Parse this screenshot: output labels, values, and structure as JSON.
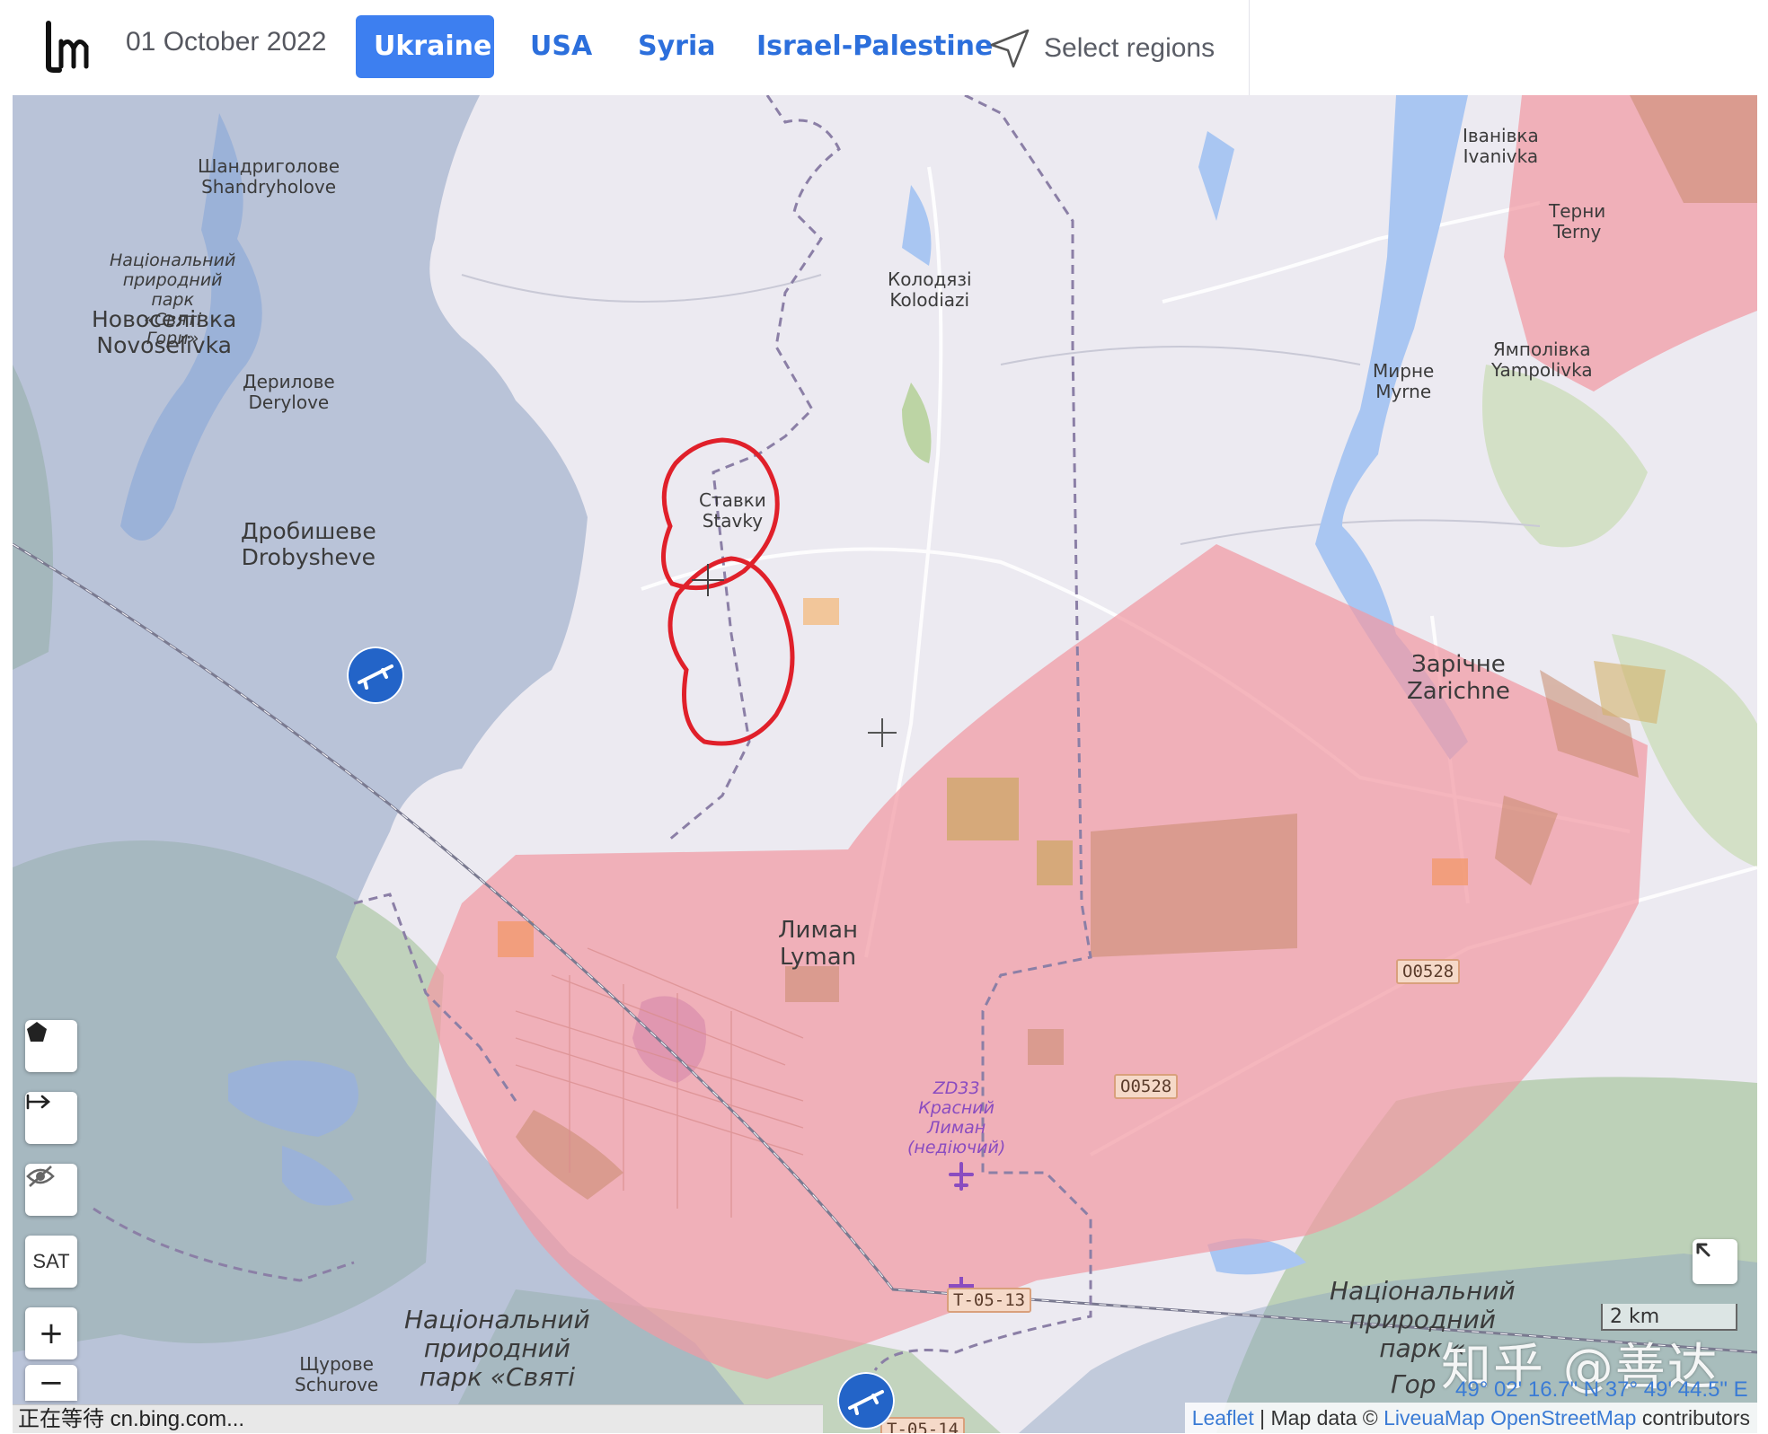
{
  "header": {
    "date": "01 October 2022",
    "tabs": [
      {
        "label": "Ukraine",
        "active": true
      },
      {
        "label": "USA",
        "active": false
      },
      {
        "label": "Syria",
        "active": false
      },
      {
        "label": "Israel-Palestine",
        "active": false
      }
    ],
    "select_regions_label": "Select regions"
  },
  "map": {
    "colors": {
      "ukraine_control": "#9fb2cf",
      "russian_control": "#f19aa3",
      "neutral": "#ecebf2",
      "water": "#a9c6f2",
      "circle_annotation": "#e0202a",
      "marker": "#2364c8"
    },
    "places": [
      {
        "uk": "Шандриголове",
        "en": "Shandryholove"
      },
      {
        "uk": "Новоселівка",
        "en": "Novoselivka"
      },
      {
        "uk": "Дерилове",
        "en": "Derylove"
      },
      {
        "uk": "Дробишеве",
        "en": "Drobysheve"
      },
      {
        "uk": "Ставки",
        "en": "Stavky"
      },
      {
        "uk": "Колодязі",
        "en": "Kolodiazi"
      },
      {
        "uk": "Іванівка",
        "en": "Ivanivka"
      },
      {
        "uk": "Терни",
        "en": "Terny"
      },
      {
        "uk": "Мирне",
        "en": "Myrne"
      },
      {
        "uk": "Ямполівка",
        "en": "Yampolivka"
      },
      {
        "uk": "Зарічне",
        "en": "Zarichne"
      },
      {
        "uk": "Лиман",
        "en": "Lyman"
      },
      {
        "uk": "Щурове",
        "en": "Schurove"
      }
    ],
    "park_label_nw": "Національний\nприродний\nпарк\n«Святі\nГори»",
    "park_label_s": "Національний\nприродний\nпарк «Святі",
    "park_label_se": "Національний\nприродний\nпарк «",
    "park_label_se_tail": "Гор",
    "airfield_label": "ZD33\nКрасний\nЛиман\n(недіючий)",
    "road_tags": [
      "O0528",
      "O0528",
      "T-05-13",
      "T-05-14"
    ],
    "controls": {
      "polygon_icon": "pentagon-icon",
      "measure_icon": "arrow-right-bar-icon",
      "hide_icon": "eye-off-icon",
      "sat_label": "SAT",
      "zoom_in_label": "+",
      "zoom_out_label": "−"
    },
    "scale_label": "2 km",
    "coords": "49° 02' 16.7\" N 37° 49' 44.5\" E"
  },
  "status_bar": "正在等待 cn.bing.com...",
  "attribution": {
    "leaflet": "Leaflet",
    "sep": " | Map data © ",
    "liveuamap": "LiveuaMap",
    "osm": "OpenStreetMap",
    "tail": " contributors"
  },
  "watermark": "知乎 @善达"
}
